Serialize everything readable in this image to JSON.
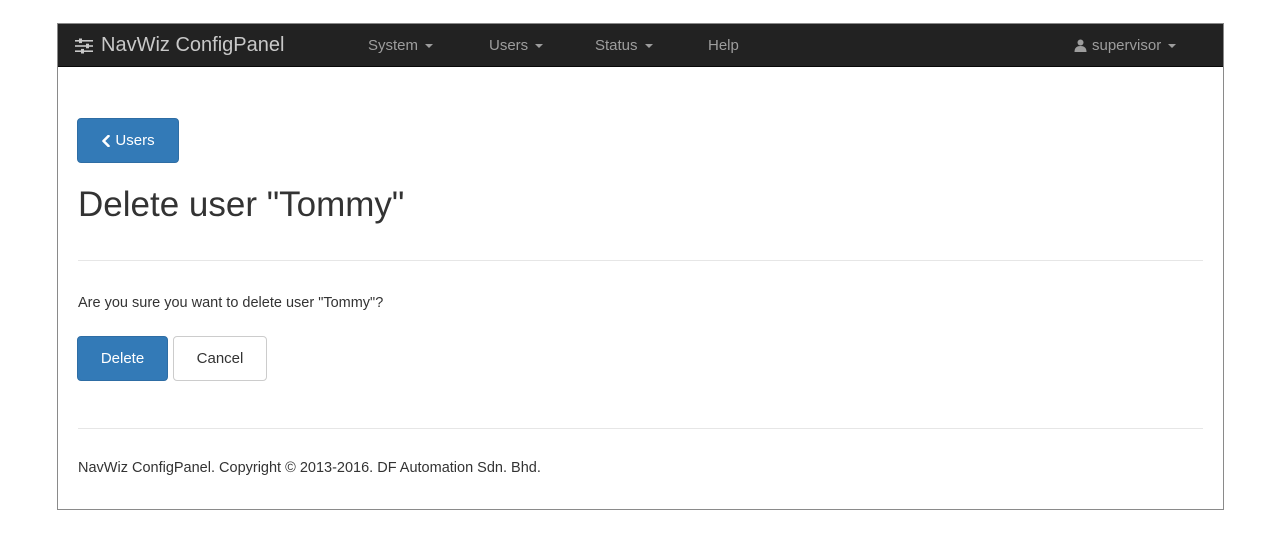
{
  "navbar": {
    "brand_icon": "sliders-icon",
    "brand": "NavWiz ConfigPanel",
    "menu": [
      {
        "label": "System",
        "has_dropdown": true
      },
      {
        "label": "Users",
        "has_dropdown": true
      },
      {
        "label": "Status",
        "has_dropdown": true
      },
      {
        "label": "Help",
        "has_dropdown": false
      }
    ],
    "user_icon": "user-icon",
    "user": "supervisor"
  },
  "back_button": {
    "icon": "chevron-left-icon",
    "label": "Users"
  },
  "page": {
    "title": "Delete user \"Tommy\"",
    "question": "Are you sure you want to delete user \"Tommy\"?",
    "delete_label": "Delete",
    "cancel_label": "Cancel"
  },
  "footer": {
    "text": "NavWiz ConfigPanel. Copyright © 2013-2016. DF Automation Sdn. Bhd."
  },
  "colors": {
    "navbar_bg": "#222222",
    "primary": "#337ab7",
    "nav_text": "#9d9d9d"
  }
}
